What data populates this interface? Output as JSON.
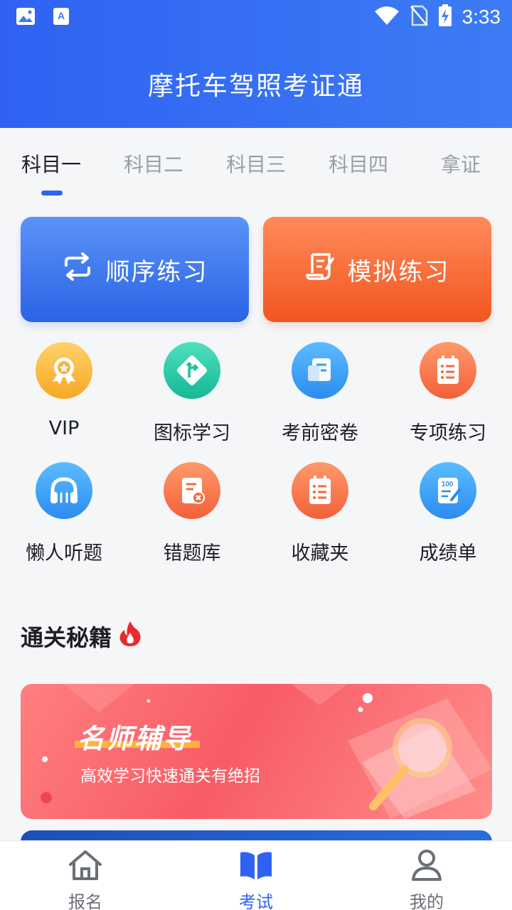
{
  "status_bar": {
    "time": "3:33"
  },
  "header": {
    "title": "摩托车驾照考证通"
  },
  "tabs": [
    {
      "label": "科目一",
      "active": true
    },
    {
      "label": "科目二",
      "active": false
    },
    {
      "label": "科目三",
      "active": false
    },
    {
      "label": "科目四",
      "active": false
    },
    {
      "label": "拿证",
      "active": false
    }
  ],
  "main_buttons": {
    "sequential": {
      "label": "顺序练习",
      "icon": "repeat-icon"
    },
    "mock": {
      "label": "模拟练习",
      "icon": "exam-paper-icon"
    }
  },
  "features": [
    {
      "label": "VIP",
      "icon": "vip-medal-icon"
    },
    {
      "label": "图标学习",
      "icon": "road-sign-icon"
    },
    {
      "label": "考前密卷",
      "icon": "document-icon"
    },
    {
      "label": "专项练习",
      "icon": "checklist-icon"
    },
    {
      "label": "懒人听题",
      "icon": "headphones-icon"
    },
    {
      "label": "错题库",
      "icon": "wrong-questions-icon"
    },
    {
      "label": "收藏夹",
      "icon": "favorites-icon"
    },
    {
      "label": "成绩单",
      "icon": "score-report-icon"
    }
  ],
  "section": {
    "title": "通关秘籍",
    "icon": "fire-icon"
  },
  "banner": {
    "title": "名师辅导",
    "subtitle": "高效学习快速通关有绝招"
  },
  "tabbar": [
    {
      "label": "报名",
      "icon": "home-icon",
      "active": false
    },
    {
      "label": "考试",
      "icon": "book-icon",
      "active": true
    },
    {
      "label": "我的",
      "icon": "user-icon",
      "active": false
    }
  ],
  "colors": {
    "primary": "#2f62f2",
    "orange": "#f2561e"
  }
}
